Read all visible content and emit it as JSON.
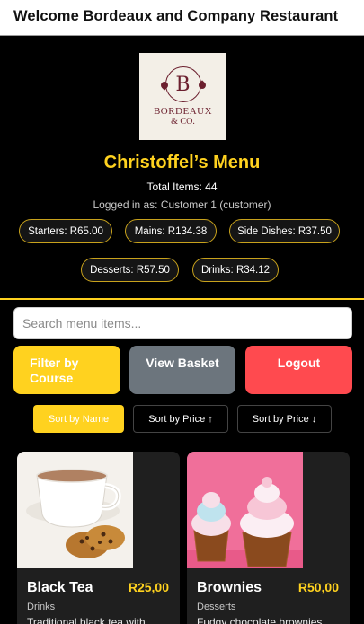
{
  "header": {
    "title": "Welcome Bordeaux and Company Restaurant"
  },
  "logo": {
    "name": "BORDEAUX",
    "sub": "& CO.",
    "monogram": "B"
  },
  "menu": {
    "title": "Christoffel’s Menu",
    "total_items": "Total Items: 44",
    "logged_in": "Logged in as: Customer 1 (customer)"
  },
  "course_totals": [
    "Starters: R65.00",
    "Mains: R134.38",
    "Side Dishes: R37.50",
    "Desserts: R57.50",
    "Drinks: R34.12"
  ],
  "search": {
    "placeholder": "Search menu items..."
  },
  "actions": {
    "filter": "Filter by Course",
    "basket": "View Basket",
    "logout": "Logout"
  },
  "sort": {
    "by_name": "Sort by Name",
    "price_asc": "Sort by Price ↑",
    "price_desc": "Sort by Price ↓"
  },
  "items": [
    {
      "name": "Black Tea",
      "price": "R25,00",
      "category": "Drinks",
      "description": "Traditional black tea with"
    },
    {
      "name": "Brownies",
      "price": "R50,00",
      "category": "Desserts",
      "description": "Fudgy chocolate brownies"
    }
  ],
  "colors": {
    "accent": "#ffd21f",
    "secondary": "#6c757d",
    "danger": "#ff4a4f",
    "background": "#000000"
  }
}
